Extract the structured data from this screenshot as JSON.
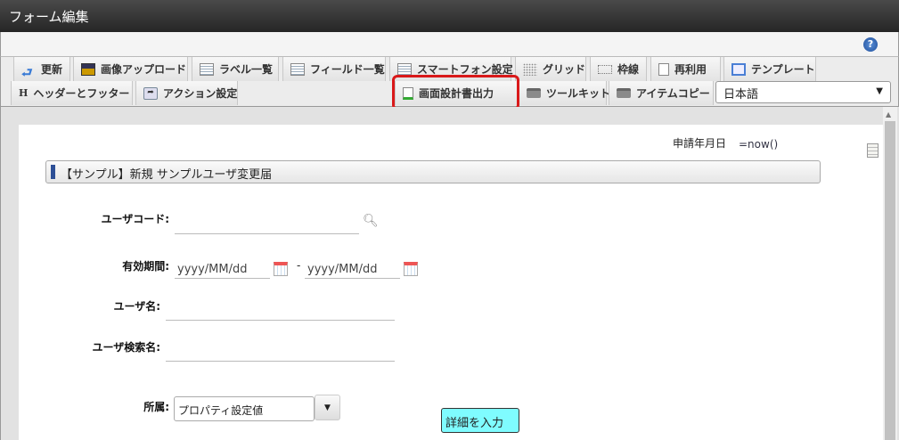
{
  "window": {
    "title": "フォーム編集"
  },
  "help_icon": "?",
  "toolbar": {
    "row1": [
      {
        "label": "更新",
        "icon": "refresh-icon"
      },
      {
        "label": "画像アップロード",
        "icon": "image-upload-icon"
      },
      {
        "label": "ラベル一覧",
        "icon": "list-icon"
      },
      {
        "label": "フィールド一覧",
        "icon": "list-icon"
      },
      {
        "label": "スマートフォン設定",
        "icon": "list-icon"
      },
      {
        "label": "グリッド",
        "icon": "grid-icon"
      },
      {
        "label": "枠線",
        "icon": "frame-icon"
      },
      {
        "label": "再利用",
        "icon": "copy-icon"
      },
      {
        "label": "テンプレート",
        "icon": "template-icon"
      }
    ],
    "row2": [
      {
        "label": "ヘッダーとフッター",
        "icon": "H"
      },
      {
        "label": "アクション設定",
        "icon": "action-icon"
      },
      {
        "label": "画面設計書出力",
        "icon": "export-icon"
      },
      {
        "label": "ツールキット",
        "icon": "toolbox-icon"
      },
      {
        "label": "アイテムコピー",
        "icon": "toolbox-icon"
      }
    ],
    "language": "日本語"
  },
  "form": {
    "date_label": "申請年月日",
    "date_value": "=now()",
    "title": "【サンプル】新規 サンプルユーザ変更届",
    "user_code_label": "ユーザコード:",
    "period_label": "有効期間:",
    "period_from_placeholder": "yyyy/MM/dd",
    "period_sep": "-",
    "period_to_placeholder": "yyyy/MM/dd",
    "user_name_label": "ユーザ名:",
    "user_search_label": "ユーザ検索名:",
    "dept_label": "所属:",
    "dept_value": "プロパティ設定値",
    "detail_button": "詳細を入力"
  },
  "colors": {
    "highlight": "#d9191a",
    "detail_button": "#7ffcff",
    "heading_bar": "#2d4f96"
  }
}
